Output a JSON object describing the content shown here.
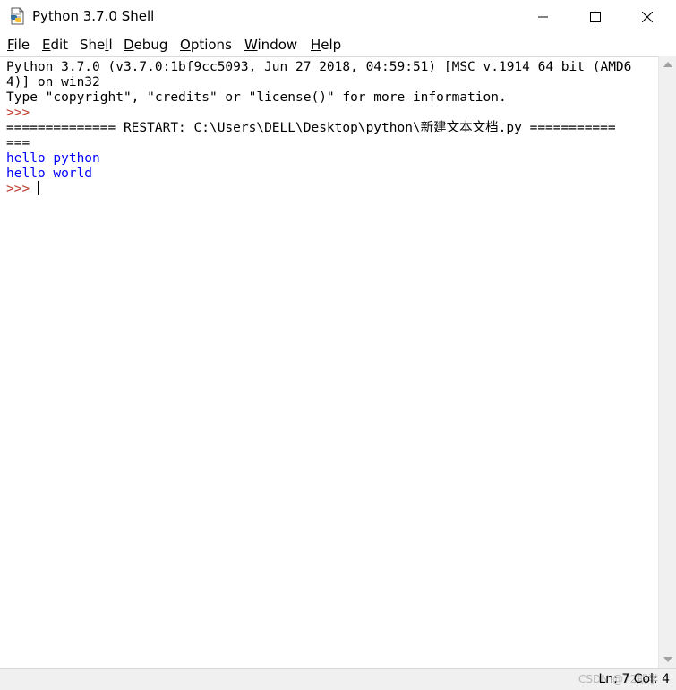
{
  "window": {
    "title": "Python 3.7.0 Shell"
  },
  "titlebar": {
    "icons": [
      "python-idle-icon",
      "minimize-icon",
      "maximize-icon",
      "close-icon"
    ]
  },
  "menu": {
    "items": [
      {
        "first": "F",
        "rest": "ile"
      },
      {
        "first": "E",
        "rest": "dit"
      },
      {
        "first": "",
        "rest": "She",
        "underline": "l",
        "tail": "l"
      },
      {
        "first": "D",
        "rest": "ebug"
      },
      {
        "first": "O",
        "rest": "ptions"
      },
      {
        "first": "W",
        "rest": "indow"
      },
      {
        "first": "H",
        "rest": "elp"
      }
    ]
  },
  "shell": {
    "lines": [
      "Python 3.7.0 (v3.7.0:1bf9cc5093, Jun 27 2018, 04:59:51) [MSC v.1914 64 bit (AMD6",
      "4)] on win32",
      "Type \"copyright\", \"credits\" or \"license()\" for more information.",
      ">>> ",
      "============== RESTART: C:\\Users\\DELL\\Desktop\\python\\新建文本文档.py ===========",
      "===",
      "hello python",
      "hello world",
      ">>> "
    ]
  },
  "statusbar": {
    "watermark": "CSDN @72期学",
    "position": "Ln: 7   Col: 4"
  },
  "colors": {
    "prompt": "#c0392b",
    "stdout": "#0000ff",
    "text": "#000000"
  }
}
